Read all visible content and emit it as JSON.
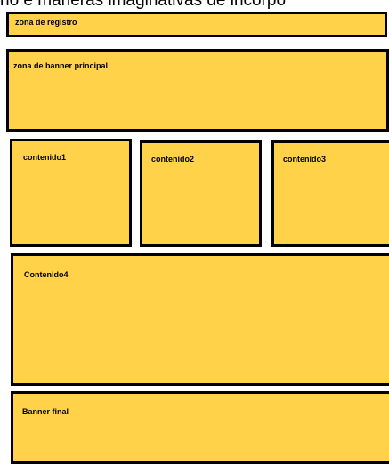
{
  "caption": "ño e maneras imaginativas de incorpo",
  "boxes": {
    "zona_registro": "zona de registro",
    "zona_banner": "zona de banner principal",
    "contenido1": "contenido1",
    "contenido2": "contenido2",
    "contenido3": "contenido3",
    "contenido4": "Contenido4",
    "banner_final": "Banner final"
  },
  "colors": {
    "box_fill": "#ffd24a",
    "box_border": "#000000"
  }
}
